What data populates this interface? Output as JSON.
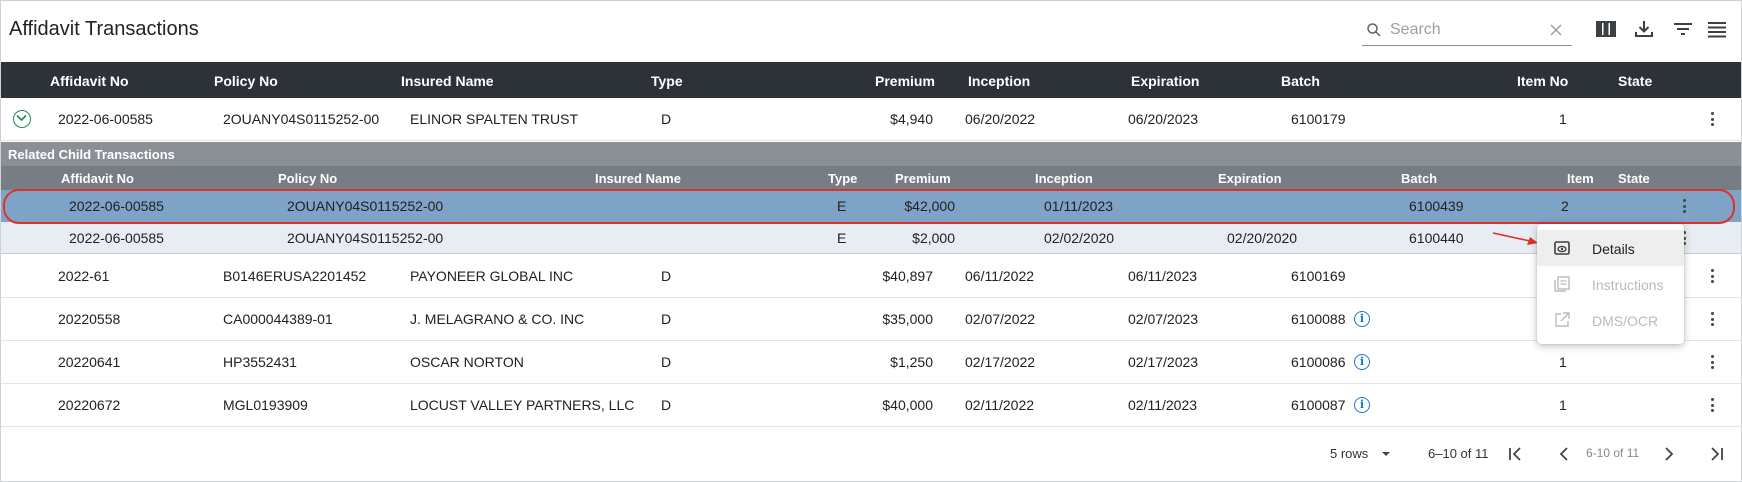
{
  "toolbar": {
    "title": "Affidavit Transactions",
    "search_placeholder": "Search",
    "icons": [
      "search-icon",
      "clear-icon",
      "columns-icon",
      "download-icon",
      "filter-icon",
      "menu-icon"
    ]
  },
  "columns": [
    "Affidavit No",
    "Policy No",
    "Insured Name",
    "Type",
    "Premium",
    "Inception",
    "Expiration",
    "Batch",
    "Item No",
    "State"
  ],
  "rows": [
    {
      "affidavit": "2022-06-00585",
      "policy": "2OUANY04S0115252-00",
      "insured": "ELINOR SPALTEN TRUST",
      "type": "D",
      "premium": "$4,940",
      "inception": "06/20/2022",
      "expiration": "06/20/2023",
      "batch": "6100179",
      "item": "1",
      "expanded": true
    },
    {
      "affidavit": "2022-61",
      "policy": "B0146ERUSA2201452",
      "insured": "PAYONEER GLOBAL INC",
      "type": "D",
      "premium": "$40,897",
      "inception": "06/11/2022",
      "expiration": "06/11/2023",
      "batch": "6100169",
      "item": ""
    },
    {
      "affidavit": "20220558",
      "policy": "CA000044389-01",
      "insured": "J. MELAGRANO & CO. INC",
      "type": "D",
      "premium": "$35,000",
      "inception": "02/07/2022",
      "expiration": "02/07/2023",
      "batch": "6100088",
      "item": "",
      "info": true
    },
    {
      "affidavit": "20220641",
      "policy": "HP3552431",
      "insured": "OSCAR NORTON",
      "type": "D",
      "premium": "$1,250",
      "inception": "02/17/2022",
      "expiration": "02/17/2023",
      "batch": "6100086",
      "item": "1",
      "info": true
    },
    {
      "affidavit": "20220672",
      "policy": "MGL0193909",
      "insured": "LOCUST VALLEY PARTNERS, LLC",
      "type": "D",
      "premium": "$40,000",
      "inception": "02/11/2022",
      "expiration": "02/11/2023",
      "batch": "6100087",
      "item": "1",
      "info": true
    }
  ],
  "related": {
    "title": "Related Child Transactions",
    "columns": [
      "Affidavit No",
      "Policy No",
      "Insured Name",
      "Type",
      "Premium",
      "Inception",
      "Expiration",
      "Batch",
      "Item",
      "State"
    ],
    "rows": [
      {
        "affidavit": "2022-06-00585",
        "policy": "2OUANY04S0115252-00",
        "type": "E",
        "premium": "$42,000",
        "inception": "01/11/2023",
        "expiration": "",
        "batch": "6100439",
        "item": "2",
        "selected": true
      },
      {
        "affidavit": "2022-06-00585",
        "policy": "2OUANY04S0115252-00",
        "type": "E",
        "premium": "$2,000",
        "inception": "02/02/2020",
        "expiration": "02/20/2020",
        "batch": "6100440",
        "item": ""
      }
    ]
  },
  "context_menu": {
    "items": [
      {
        "label": "Details",
        "icon": "details-icon",
        "enabled": true
      },
      {
        "label": "Instructions",
        "icon": "instructions-icon",
        "enabled": false
      },
      {
        "label": "DMS/OCR",
        "icon": "external-link-icon",
        "enabled": false
      }
    ]
  },
  "pagination": {
    "rows_per_page": "5 rows",
    "range": "6–10 of 11",
    "range_small": "6-10 of 11"
  },
  "colors": {
    "header_bg": "#2d3239",
    "selected_row": "#7fa2c7",
    "annotation_red": "#e0302a",
    "info_blue": "#1976d2"
  }
}
